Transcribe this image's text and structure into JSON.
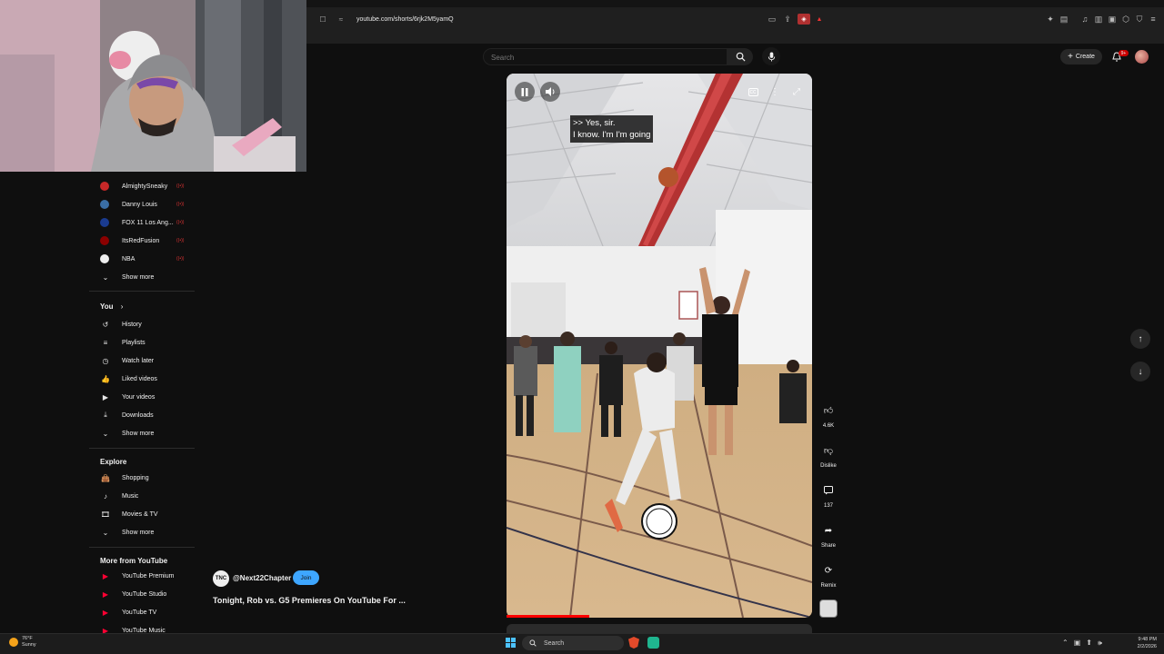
{
  "browser": {
    "url": "youtube.com/shorts/6rjk2M5yamQ"
  },
  "header": {
    "search_placeholder": "Search",
    "create_label": "Create",
    "notification_count": "9+"
  },
  "sidebar": {
    "subscriptions": [
      {
        "label": "AlmightySneaky",
        "color": "#c62828"
      },
      {
        "label": "Danny Louis",
        "color": "#3a6ea5"
      },
      {
        "label": "FOX 11 Los Ang...",
        "color": "#1a3b8f"
      },
      {
        "label": "ItsRedFusion",
        "color": "#8b0000"
      },
      {
        "label": "NBA",
        "color": "#eeeeee"
      }
    ],
    "subs_show_more": "Show more",
    "you_heading": "You",
    "you_items": [
      {
        "label": "History",
        "icon": "history-icon",
        "glyph": "↺"
      },
      {
        "label": "Playlists",
        "icon": "playlists-icon",
        "glyph": "≡"
      },
      {
        "label": "Watch later",
        "icon": "clock-icon",
        "glyph": "◷"
      },
      {
        "label": "Liked videos",
        "icon": "thumbs-up-icon",
        "glyph": "👍"
      },
      {
        "label": "Your videos",
        "icon": "play-square-icon",
        "glyph": "▶"
      },
      {
        "label": "Downloads",
        "icon": "download-icon",
        "glyph": "⤓"
      }
    ],
    "you_show_more": "Show more",
    "explore_heading": "Explore",
    "explore_items": [
      {
        "label": "Shopping",
        "icon": "shopping-bag-icon",
        "glyph": "👜"
      },
      {
        "label": "Music",
        "icon": "music-note-icon",
        "glyph": "♪"
      },
      {
        "label": "Movies & TV",
        "icon": "film-icon",
        "glyph": "🎞"
      }
    ],
    "explore_show_more": "Show more",
    "more_heading": "More from YouTube",
    "more_items": [
      {
        "label": "YouTube Premium"
      },
      {
        "label": "YouTube Studio"
      },
      {
        "label": "YouTube TV"
      },
      {
        "label": "YouTube Music"
      }
    ]
  },
  "video": {
    "caption": ">> Yes, sir.\nI know. I'm I'm going",
    "progress": 0.27
  },
  "actions": {
    "likes": "4.6K",
    "dislike": "Dislike",
    "comments": "137",
    "share": "Share",
    "remix": "Remix"
  },
  "channel": {
    "handle": "@Next22Chapter",
    "avatar_text": "TNC",
    "join_label": "Join",
    "title": "Tonight, Rob vs. G5 Premieres On YouTube For ..."
  },
  "taskbar": {
    "temp": "76°F",
    "condition": "Sunny",
    "search_label": "Search",
    "time": "9:48 PM",
    "date": "2/2/2026"
  }
}
